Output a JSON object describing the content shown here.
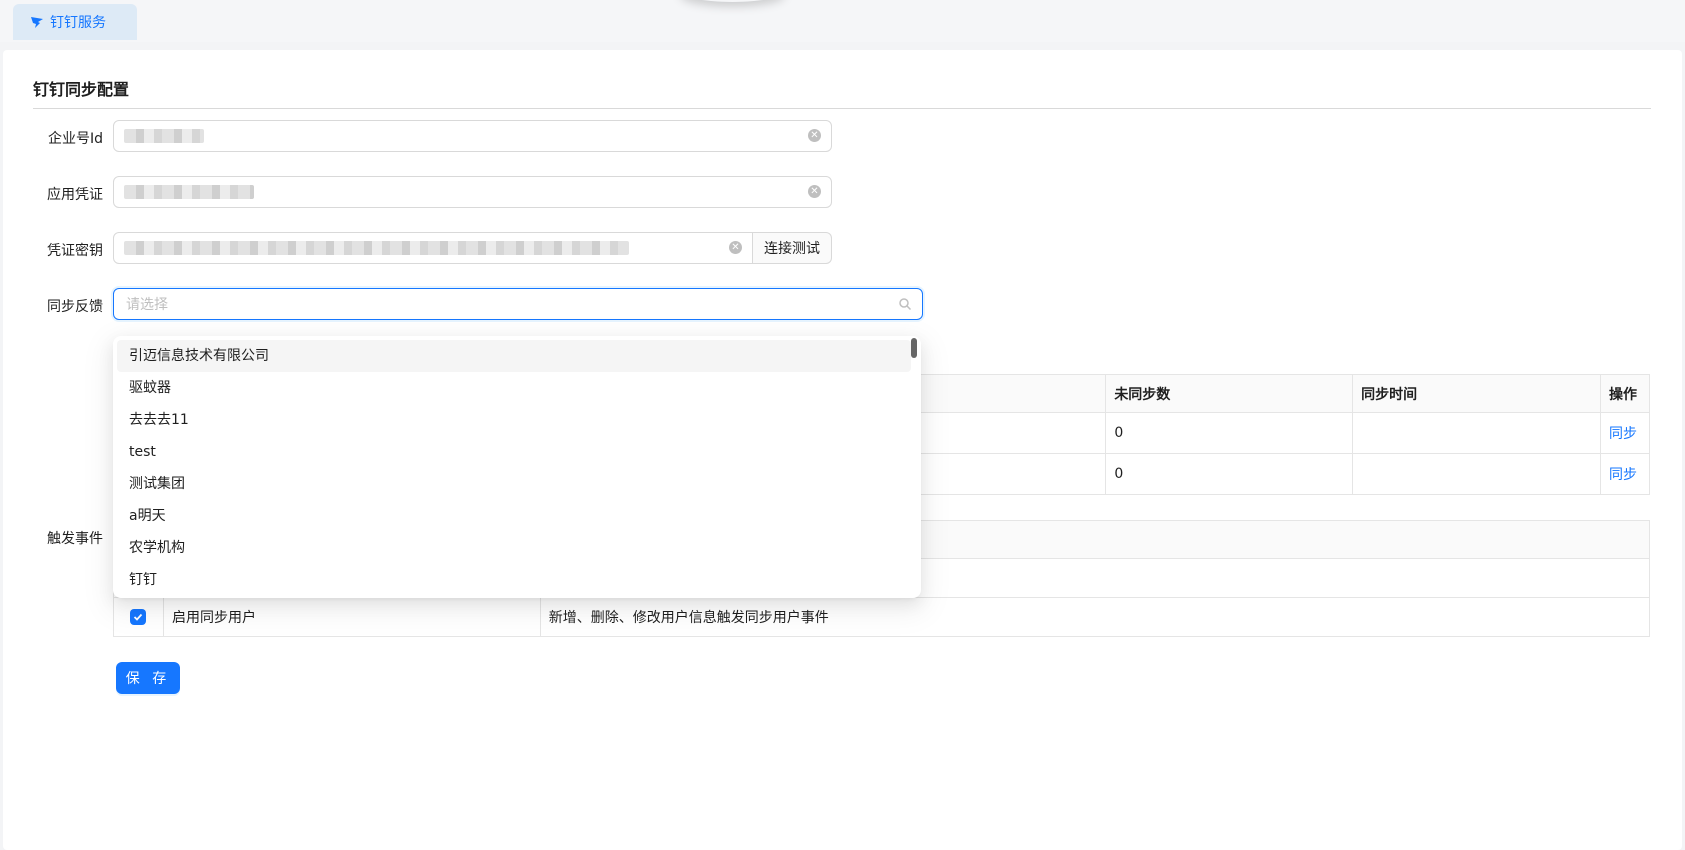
{
  "tabs": [
    {
      "label": "钉钉服务"
    }
  ],
  "section": {
    "title": "钉钉同步配置"
  },
  "form": {
    "corp_id": {
      "label": "企业号Id"
    },
    "app_key": {
      "label": "应用凭证"
    },
    "app_secret": {
      "label": "凭证密钥",
      "test_button": "连接测试"
    },
    "sync_feedback": {
      "label": "同步反馈",
      "placeholder": "请选择"
    },
    "trigger_events": {
      "label": "触发事件"
    }
  },
  "dropdown": {
    "options": [
      "引迈信息技术有限公司",
      "驱蚊器",
      "去去去11",
      "test",
      "测试集团",
      "a明天",
      "农学机构",
      "钉钉"
    ]
  },
  "sync_table": {
    "headers": [
      "未同步数",
      "同步时间",
      "操作"
    ],
    "rows": [
      {
        "unsynced": "0",
        "time": "",
        "action": "同步"
      },
      {
        "unsynced": "0",
        "time": "",
        "action": "同步"
      }
    ]
  },
  "events_table": {
    "rows": [
      {
        "checked": true,
        "name": "启用同步用户",
        "desc": "新增、删除、修改用户信息触发同步用户事件"
      }
    ]
  },
  "save_button": "保 存",
  "colors": {
    "accent": "#1677ff",
    "tab_bg": "#ddeaf6"
  }
}
